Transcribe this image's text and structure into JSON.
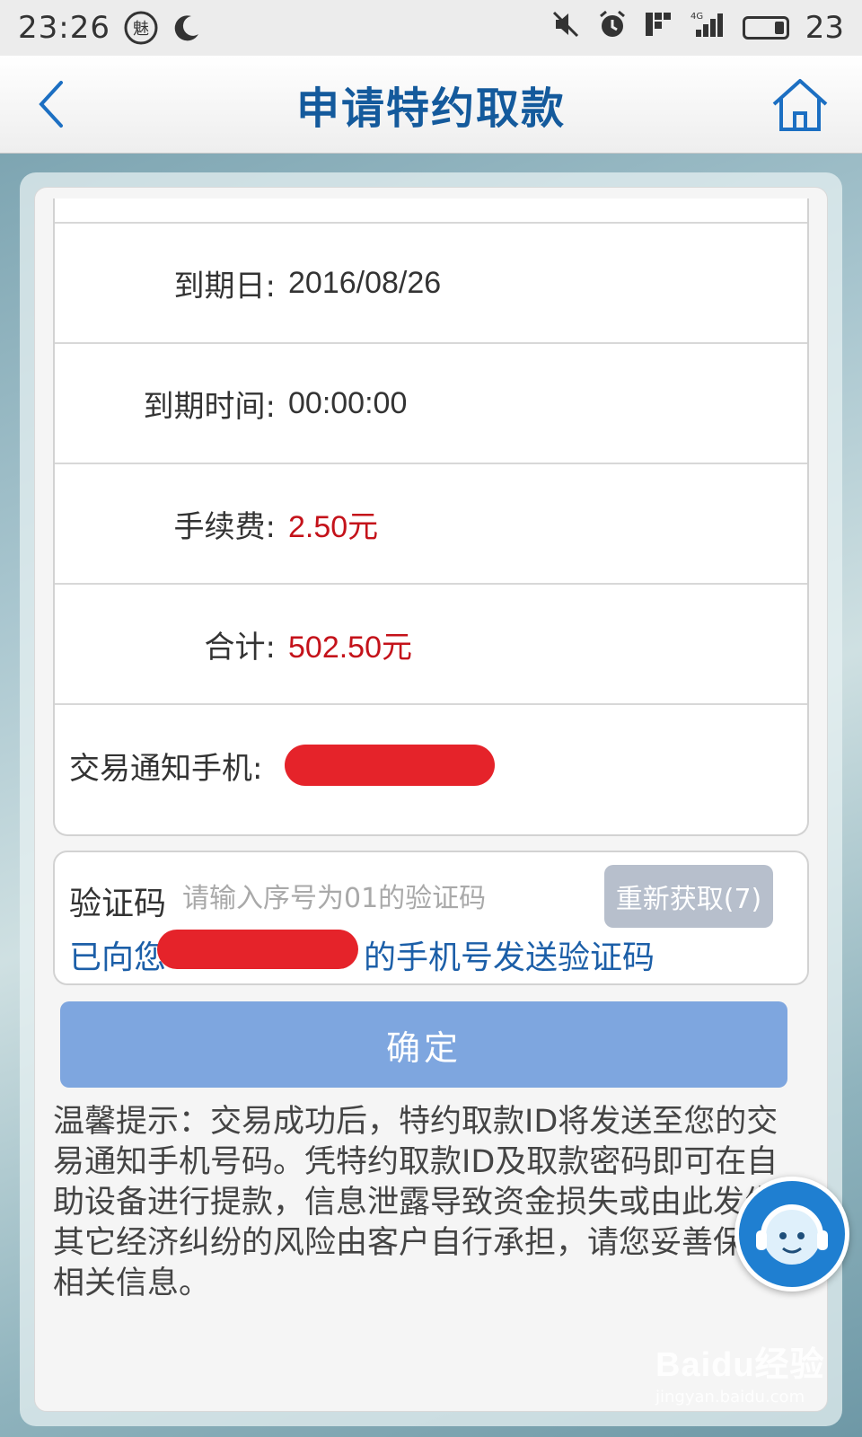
{
  "status_bar": {
    "time": "23:26",
    "battery": "23"
  },
  "header": {
    "title": "申请特约取款"
  },
  "info_rows": [
    {
      "label": "到期日:",
      "value": "2016/08/26"
    },
    {
      "label": "到期时间:",
      "value": "00:00:00"
    },
    {
      "label": "手续费:",
      "value": "2.50元"
    },
    {
      "label": "合计:",
      "value": "502.50元"
    },
    {
      "label": "交易通知手机:",
      "value": ""
    }
  ],
  "verification": {
    "label": "验证码",
    "placeholder": "请输入序号为01的验证码",
    "resend_label": "重新获取(7)",
    "sent_prefix": "已向您",
    "sent_suffix": "的手机号发送验证码"
  },
  "confirm_label": "确定",
  "tip_text": "温馨提示：交易成功后，特约取款ID将发送至您的交易通知手机号码。凭特约取款ID及取款密码即可在自助设备进行提款，信息泄露导致资金损失或由此发生其它经济纠纷的风险由客户自行承担，请您妥善保管相关信息。",
  "watermark": {
    "main": "Baidu经验",
    "sub": "jingyan.baidu.com"
  },
  "colors": {
    "title_blue": "#145a9c",
    "amount_red": "#c4121a",
    "confirm_button": "#7ea6df",
    "resend_button": "#b7bfcc",
    "service_blue": "#1f7fd1"
  },
  "icons": [
    "back-chevron-icon",
    "home-icon",
    "customer-service-icon",
    "mute-icon",
    "alarm-icon",
    "signal-icon",
    "battery-icon",
    "moon-icon"
  ]
}
